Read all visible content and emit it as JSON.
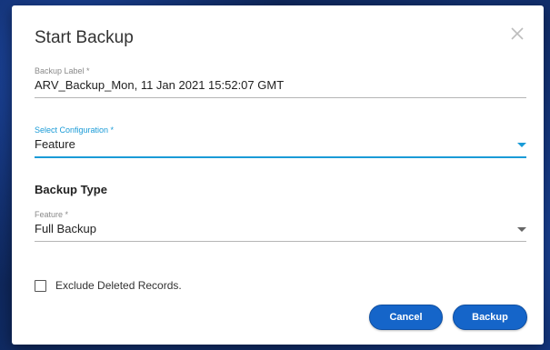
{
  "dialog": {
    "title": "Start Backup",
    "close_icon": "close-icon",
    "backup_label": {
      "label": "Backup Label *",
      "value": "ARV_Backup_Mon, 11 Jan 2021 15:52:07 GMT"
    },
    "configuration": {
      "label": "Select Configuration *",
      "value": "Feature",
      "caret_icon": "caret-down-icon"
    },
    "backup_type": {
      "section_title": "Backup Type",
      "feature": {
        "label": "Feature *",
        "value": "Full Backup",
        "caret_icon": "caret-down-icon"
      }
    },
    "exclude_deleted": {
      "label": "Exclude Deleted Records.",
      "checked": false
    },
    "buttons": {
      "cancel": "Cancel",
      "backup": "Backup"
    }
  },
  "colors": {
    "accent": "#1a9bd7",
    "button": "#1565c9",
    "backdrop": "#0b1f4a"
  }
}
